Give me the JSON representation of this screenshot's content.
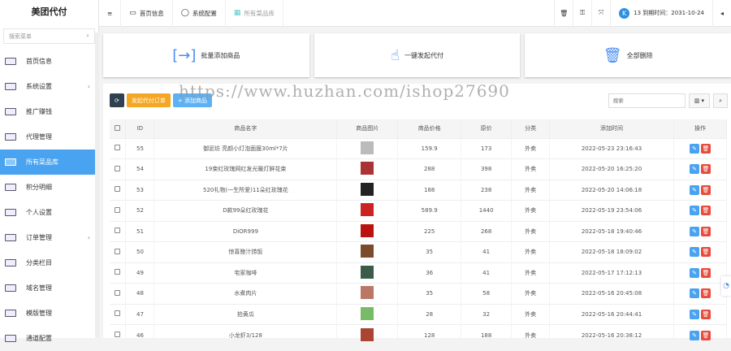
{
  "sidebar": {
    "logo": "美团代付",
    "search_placeholder": "搜索菜单",
    "items": [
      {
        "label": "首页信息",
        "has_arrow": false
      },
      {
        "label": "系统设置",
        "has_arrow": true
      },
      {
        "label": "推广赚钱",
        "has_arrow": false
      },
      {
        "label": "代理管理",
        "has_arrow": false
      },
      {
        "label": "所有菜品库",
        "has_arrow": false,
        "active": true
      },
      {
        "label": "积分明细",
        "has_arrow": false
      },
      {
        "label": "个人设置",
        "has_arrow": false
      },
      {
        "label": "订单管理",
        "has_arrow": true
      },
      {
        "label": "分类栏目",
        "has_arrow": false
      },
      {
        "label": "域名管理",
        "has_arrow": false
      },
      {
        "label": "模版管理",
        "has_arrow": false
      },
      {
        "label": "通道配置",
        "has_arrow": false
      }
    ]
  },
  "header": {
    "tabs": [
      "首页信息",
      "系统配置",
      "所有菜品库"
    ],
    "user_text": "13 到期时间：2031-10-24",
    "avatar": "K"
  },
  "cards": [
    "批量添加商品",
    "一键发起代付",
    "全部删除"
  ],
  "toolbar": {
    "order_btn": "发起代付订单",
    "add_btn": "+ 添加商品",
    "search_placeholder": "搜索"
  },
  "table": {
    "headers": [
      "ID",
      "商品名字",
      "商品图片",
      "商品价格",
      "原价",
      "分类",
      "添加时间",
      "操作"
    ],
    "rows": [
      [
        "55",
        "御泥坊 亮颜小灯泡面膜30ml*7片",
        "159.9",
        "173",
        "外卖",
        "2022-05-23 23:16:43"
      ],
      [
        "54",
        "19束红玫瑰网红发光暖灯鲜花束",
        "288",
        "398",
        "外卖",
        "2022-05-20 16:25:20"
      ],
      [
        "53",
        "520礼物(一生所爱)11朵红玫瑰花",
        "188",
        "238",
        "外卖",
        "2022-05-20 14:06:18"
      ],
      [
        "52",
        "D款99朵红玫瑰花",
        "589.9",
        "1440",
        "外卖",
        "2022-05-19 23:54:06"
      ],
      [
        "51",
        "DiOR999",
        "225",
        "268",
        "外卖",
        "2022-05-18 19:40:46"
      ],
      [
        "50",
        "惊喜鲍汁捞饭",
        "35",
        "41",
        "外卖",
        "2022-05-18 18:09:02"
      ],
      [
        "49",
        "宅家咖啡",
        "36",
        "41",
        "外卖",
        "2022-05-17 17:12:13"
      ],
      [
        "48",
        "水煮肉片",
        "35",
        "58",
        "外卖",
        "2022-05-16 20:45:08"
      ],
      [
        "47",
        "拍黄瓜",
        "28",
        "32",
        "外卖",
        "2022-05-16 20:44:41"
      ],
      [
        "46",
        "小龙虾3/128",
        "128",
        "188",
        "外卖",
        "2022-05-16 20:38:12"
      ]
    ]
  },
  "watermark": "https://www.huzhan.com/ishop27690",
  "colors": {
    "accent": "#4aa3f0",
    "orange": "#f5a623",
    "danger": "#e74c3c",
    "dark": "#2f4050"
  }
}
